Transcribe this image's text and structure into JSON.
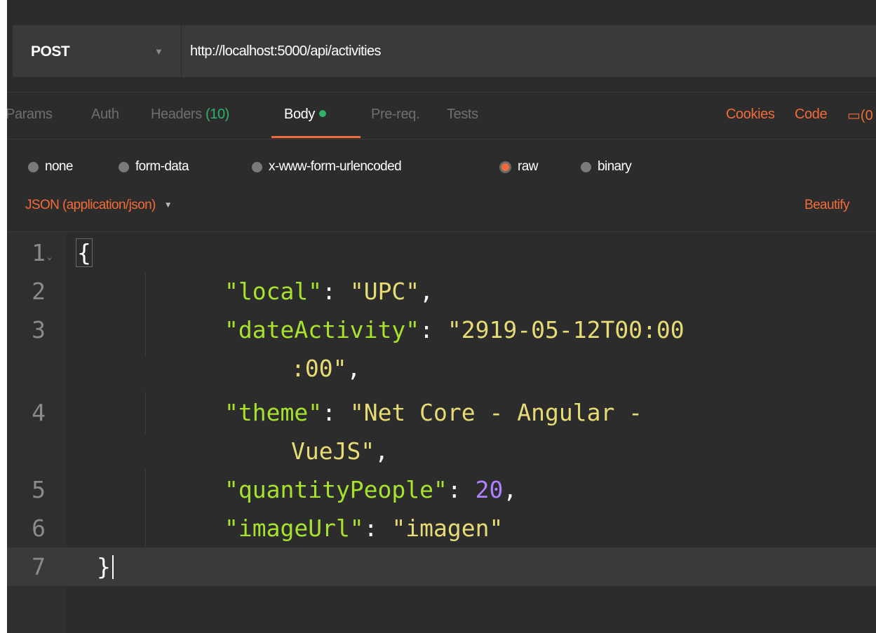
{
  "request": {
    "method": "POST",
    "url": "http://localhost:5000/api/activities"
  },
  "tabs": {
    "params": "Params",
    "auth": "Auth",
    "headers": "Headers",
    "headers_count": "(10)",
    "body": "Body",
    "prereq": "Pre-req.",
    "tests": "Tests",
    "cookies": "Cookies",
    "code": "Code",
    "comments_partial": "(0"
  },
  "body_types": {
    "none": "none",
    "form_data": "form-data",
    "urlencoded": "x-www-form-urlencoded",
    "raw": "raw",
    "binary": "binary",
    "selected": "raw"
  },
  "content_type": "JSON (application/json)",
  "beautify": "Beautify",
  "editor": {
    "line_numbers": [
      "1",
      "2",
      "3",
      "4",
      "5",
      "6",
      "7"
    ],
    "open_brace": "{",
    "close_brace": "}",
    "lines": [
      {
        "key": "\"local\"",
        "value": "\"UPC\""
      },
      {
        "key": "\"dateActivity\"",
        "value": "\"2919-05-12T00:00",
        "value_wrap": ":00\""
      },
      {
        "key": "\"theme\"",
        "value": "\"Net Core - Angular -",
        "value_wrap": "VueJS\""
      },
      {
        "key": "\"quantityPeople\"",
        "value": "20"
      },
      {
        "key": "\"imageUrl\"",
        "value": "\"imagen\""
      }
    ]
  },
  "colors": {
    "accent": "#f26b3a",
    "success": "#2fb36a",
    "json_key": "#a6e22e",
    "json_string": "#e6db74",
    "json_number": "#ae81ff"
  }
}
